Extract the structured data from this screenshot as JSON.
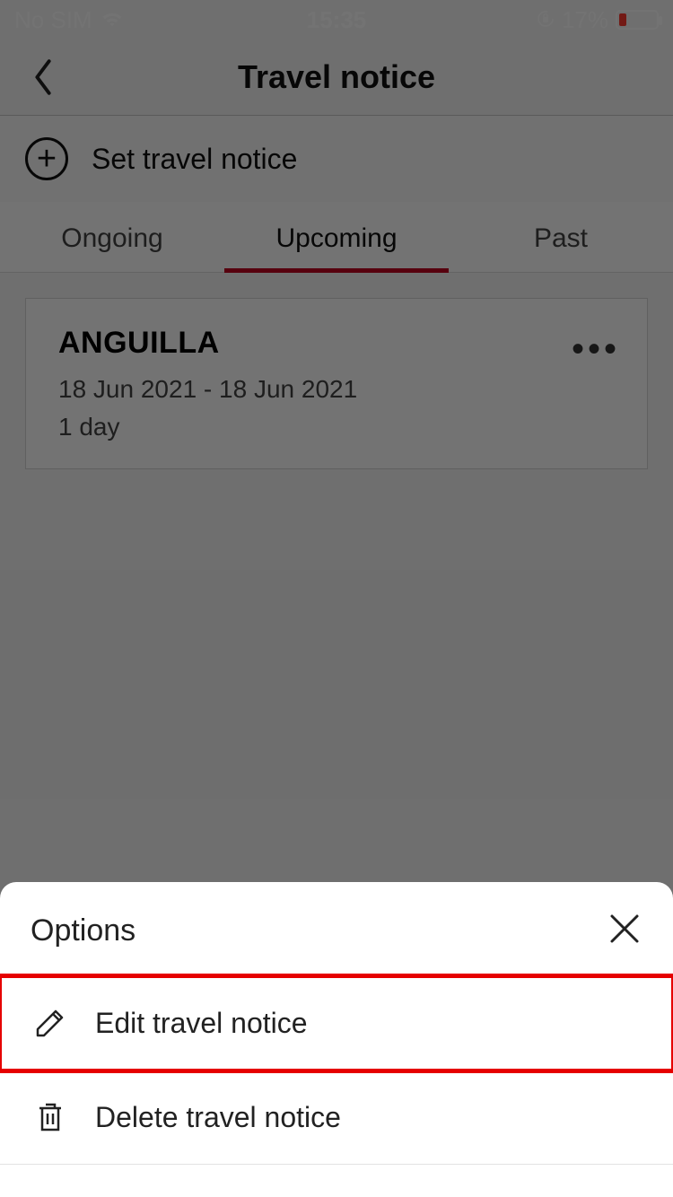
{
  "status": {
    "carrier": "No SIM",
    "time": "15:35",
    "battery_pct": "17%"
  },
  "header": {
    "title": "Travel notice"
  },
  "set_notice_label": "Set travel notice",
  "tabs": {
    "ongoing": "Ongoing",
    "upcoming": "Upcoming",
    "past": "Past"
  },
  "card": {
    "title": "ANGUILLA",
    "dates": "18 Jun 2021 - 18 Jun 2021",
    "duration": "1 day"
  },
  "sheet": {
    "title": "Options",
    "edit": "Edit travel notice",
    "delete": "Delete travel notice"
  }
}
